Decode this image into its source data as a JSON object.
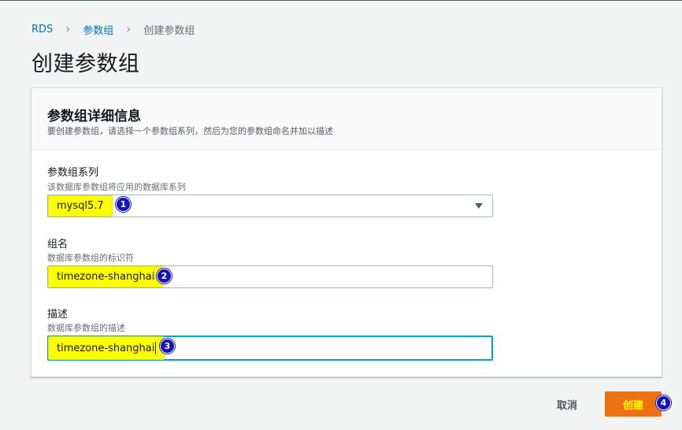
{
  "breadcrumb": {
    "items": [
      "RDS",
      "参数组",
      "创建参数组"
    ]
  },
  "page_title": "创建参数组",
  "panel": {
    "title": "参数组详细信息",
    "description": "要创建参数组，请选择一个参数组系列，然后为您的参数组命名并加以描述"
  },
  "fields": {
    "family": {
      "label": "参数组系列",
      "hint": "该数据库参数组将应用的数据库系列",
      "value": "mysql5.7",
      "badge": "1"
    },
    "group_name": {
      "label": "组名",
      "hint": "数据库参数组的标识符",
      "value": "timezone-shanghai",
      "badge": "2"
    },
    "description": {
      "label": "描述",
      "hint": "数据库参数组的描述",
      "value": "timezone-shanghai",
      "badge": "3"
    }
  },
  "actions": {
    "cancel_label": "取消",
    "create_label": "创建",
    "create_badge": "4"
  },
  "colors": {
    "primary_button": "#ec7211",
    "link": "#0073bb",
    "focus": "#00a1c9",
    "highlight": "#ffff00",
    "badge": "#1414b8"
  }
}
